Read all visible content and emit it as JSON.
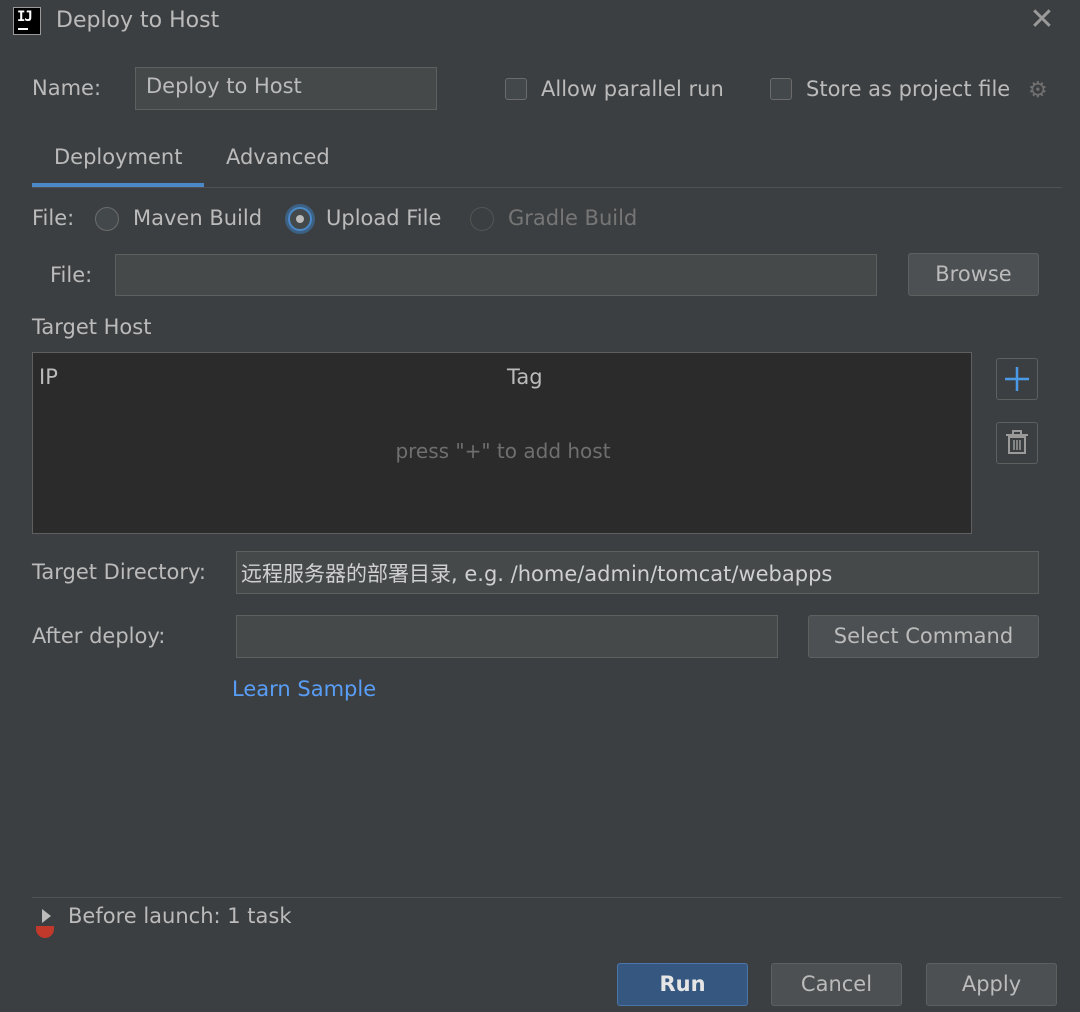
{
  "window": {
    "title": "Deploy to Host",
    "app_icon_text": "IJ"
  },
  "name_row": {
    "label": "Name:",
    "value": "Deploy to Host",
    "allow_parallel_label": "Allow parallel run",
    "store_project_label": "Store as project file"
  },
  "tabs": [
    {
      "label": "Deployment",
      "active": true
    },
    {
      "label": "Advanced",
      "active": false
    }
  ],
  "file_type": {
    "label": "File:",
    "options": [
      {
        "label": "Maven Build",
        "state": "unselected"
      },
      {
        "label": "Upload File",
        "state": "selected"
      },
      {
        "label": "Gradle Build",
        "state": "disabled"
      }
    ]
  },
  "file_row": {
    "label": "File:",
    "value": "",
    "browse_label": "Browse"
  },
  "target_host": {
    "section_label": "Target Host",
    "columns": [
      "IP",
      "Tag"
    ],
    "empty_text": "press \"+\" to add host"
  },
  "target_directory": {
    "label": "Target Directory:",
    "placeholder": "远程服务器的部署目录, e.g. /home/admin/tomcat/webapps"
  },
  "after_deploy": {
    "label": "After deploy:",
    "value": "",
    "select_label": "Select Command",
    "learn_label": "Learn Sample"
  },
  "before_launch": {
    "label": "Before launch: 1 task"
  },
  "buttons": {
    "run": "Run",
    "cancel": "Cancel",
    "apply": "Apply"
  },
  "colors": {
    "background": "#3c3f41",
    "accent": "#4a88c7",
    "link": "#589df6",
    "primary_button": "#365880",
    "error": "#c0392b"
  },
  "icons": {
    "close": "close-icon",
    "gear": "gear-icon",
    "add": "plus-icon",
    "delete": "trash-icon",
    "expand": "triangle-right-icon"
  }
}
